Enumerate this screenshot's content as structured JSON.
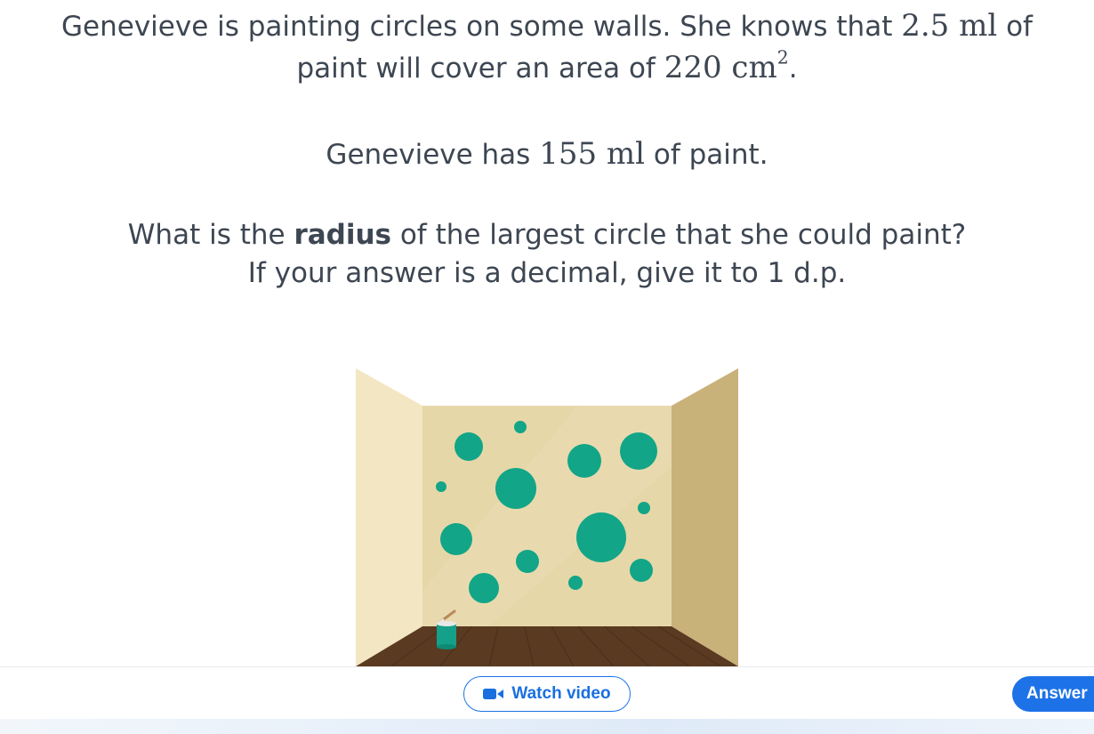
{
  "question": {
    "line1": {
      "pre": "Genevieve is painting circles on some walls. She knows that ",
      "paint_amount": "2.5",
      "paint_unit": "ml",
      "post": " of"
    },
    "line2": {
      "pre": "paint will cover an area of ",
      "area_value": "220",
      "area_unit": "cm",
      "area_exp": "2",
      "post": "."
    },
    "line3": {
      "pre": "Genevieve has ",
      "has_value": "155",
      "has_unit": "ml",
      "post": " of paint."
    },
    "line4": {
      "pre": "What is the ",
      "bold": "radius",
      "post": " of the largest circle that she could paint?"
    },
    "line5": "If your answer is a decimal, give it to 1 d.p."
  },
  "illustration": {
    "wall_color": "#e6d7a8",
    "left_wall_color": "#f3e6c2",
    "right_wall_color": "#c9b27a",
    "floor_color": "#5a3a20",
    "circle_color": "#12a587"
  },
  "footer": {
    "watch_video_label": "Watch video",
    "answer_label": "Answer",
    "accent_color": "#1d72e8"
  }
}
